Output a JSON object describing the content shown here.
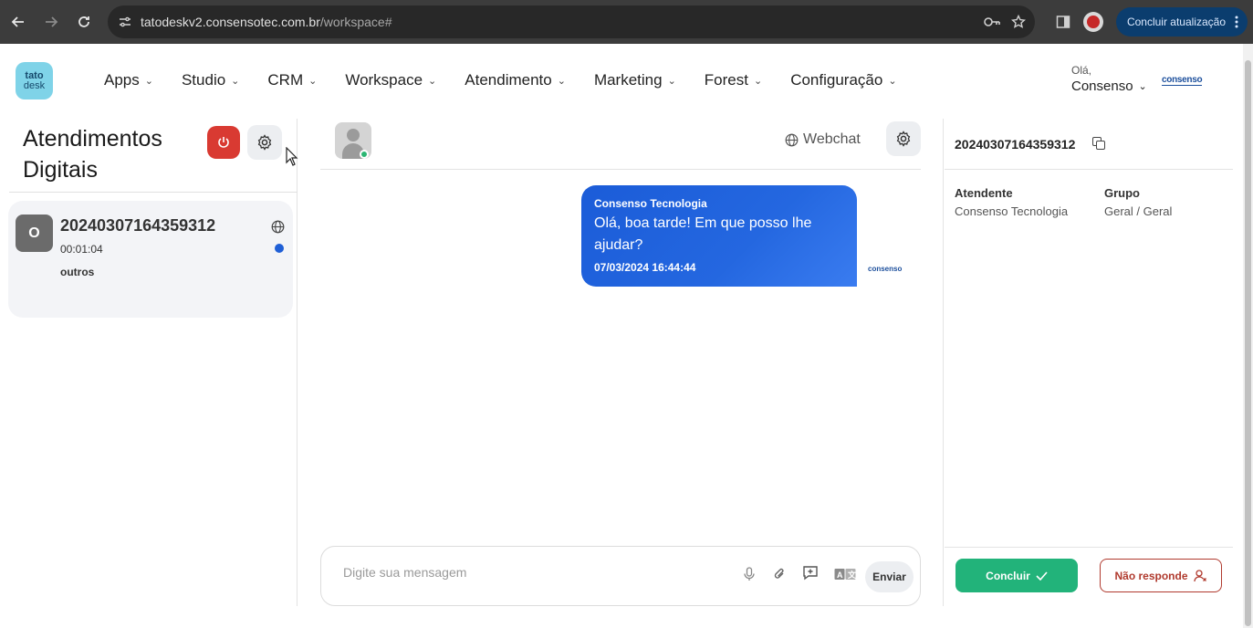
{
  "browser": {
    "url_host": "tatodeskv2.consensotec.com.br",
    "url_path": "/workspace#",
    "update_label": "Concluir atualização"
  },
  "app": {
    "logo_line1": "tato",
    "logo_line2": "desk",
    "menu": [
      "Apps",
      "Studio",
      "CRM",
      "Workspace",
      "Atendimento",
      "Marketing",
      "Forest",
      "Configuração"
    ],
    "user_greeting": "Olá,",
    "user_name": "Consenso",
    "brand": "consenso"
  },
  "left_panel": {
    "title": "Atendimentos Digitais",
    "ticket": {
      "avatar_letter": "O",
      "id": "20240307164359312",
      "elapsed": "00:01:04",
      "category": "outros"
    }
  },
  "chat": {
    "channel": "Webchat",
    "message": {
      "sender": "Consenso Tecnologia",
      "text": "Olá, boa tarde! Em que posso lhe ajudar?",
      "timestamp": "07/03/2024 16:44:44",
      "brand": "consenso"
    },
    "composer": {
      "placeholder": "Digite sua mensagem",
      "send_label": "Enviar"
    }
  },
  "right_panel": {
    "ticket_id": "20240307164359312",
    "agent_label": "Atendente",
    "agent_value": "Consenso Tecnologia",
    "group_label": "Grupo",
    "group_value": "Geral / Geral",
    "conclude_label": "Concluir",
    "no_response_label": "Não responde"
  },
  "colors": {
    "accent_blue": "#1b5cd8",
    "danger": "#d93a32",
    "success": "#22b37a",
    "no_response": "#b03a2e"
  }
}
